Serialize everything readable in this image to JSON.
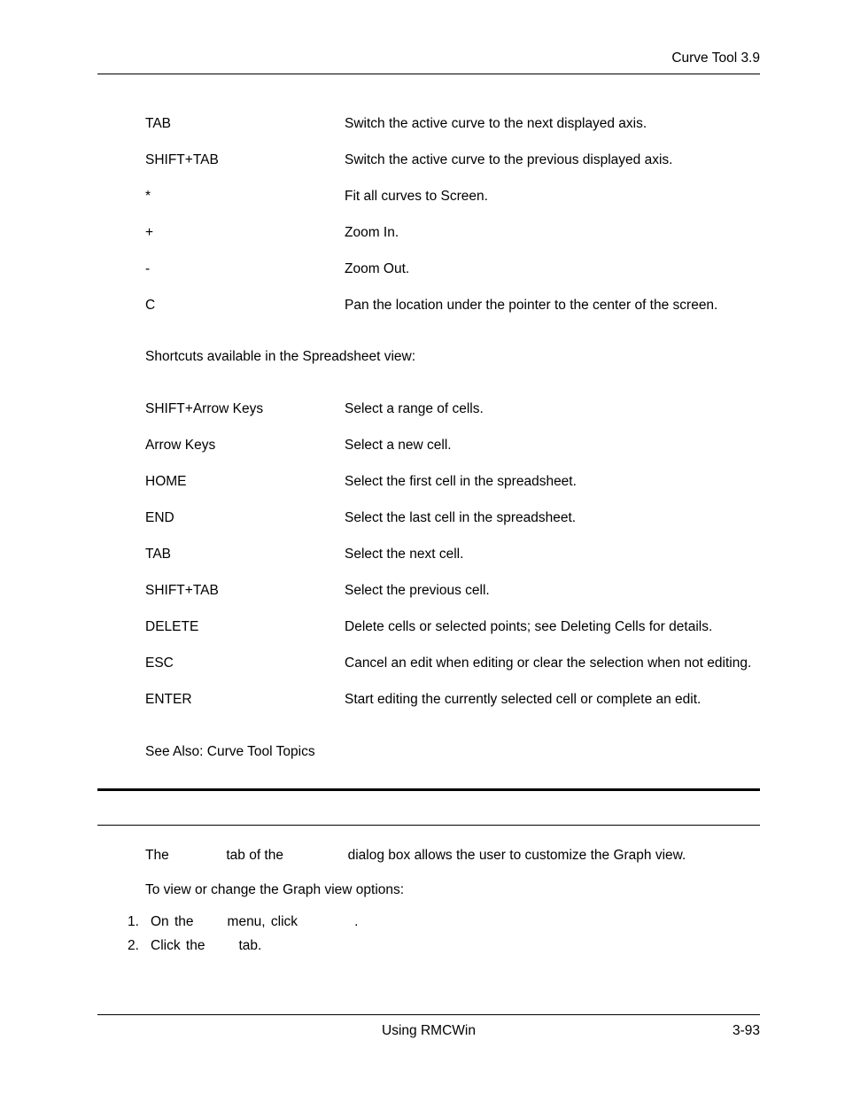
{
  "header": {
    "running_title": "Curve Tool  3.9"
  },
  "shortcuts_graph": [
    {
      "key": "TAB",
      "desc": "Switch the active curve to the next displayed axis."
    },
    {
      "key": "SHIFT+TAB",
      "desc": "Switch the active curve to the previous displayed axis."
    },
    {
      "key": "*",
      "desc": "Fit all curves to Screen."
    },
    {
      "key": "+",
      "desc": "Zoom In."
    },
    {
      "key": "-",
      "desc": "Zoom Out."
    },
    {
      "key": "C",
      "desc": "Pan the location under the pointer to the center of the screen."
    }
  ],
  "spreadsheet_intro": "Shortcuts available in the Spreadsheet view:",
  "shortcuts_spreadsheet": [
    {
      "key": "SHIFT+Arrow Keys",
      "desc": "Select a range of cells."
    },
    {
      "key": "Arrow Keys",
      "desc": "Select a new cell."
    },
    {
      "key": "HOME",
      "desc": "Select the first cell in the spreadsheet."
    },
    {
      "key": "END",
      "desc": "Select the last cell in the spreadsheet."
    },
    {
      "key": "TAB",
      "desc": "Select the next cell."
    },
    {
      "key": "SHIFT+TAB",
      "desc": "Select the previous cell."
    },
    {
      "key": "DELETE",
      "desc": "Delete cells or selected points; see Deleting Cells for details."
    },
    {
      "key": "ESC",
      "desc": "Cancel an edit when editing or clear the selection when not editing."
    },
    {
      "key": "ENTER",
      "desc": "Start editing the currently selected cell or complete an edit."
    }
  ],
  "see_also": "See Also: Curve Tool Topics",
  "graph_section": {
    "line1_a": "The",
    "line1_b": "tab of the",
    "line1_c": "dialog box allows the user to customize the Graph view.",
    "line2": "To view or change the Graph view options:",
    "steps": [
      {
        "n": "1.",
        "a": "On the",
        "b": "menu, click",
        "c": "."
      },
      {
        "n": "2.",
        "a": "Click the",
        "b": "tab.",
        "c": ""
      }
    ]
  },
  "footer": {
    "center": "Using RMCWin",
    "right": "3-93"
  }
}
